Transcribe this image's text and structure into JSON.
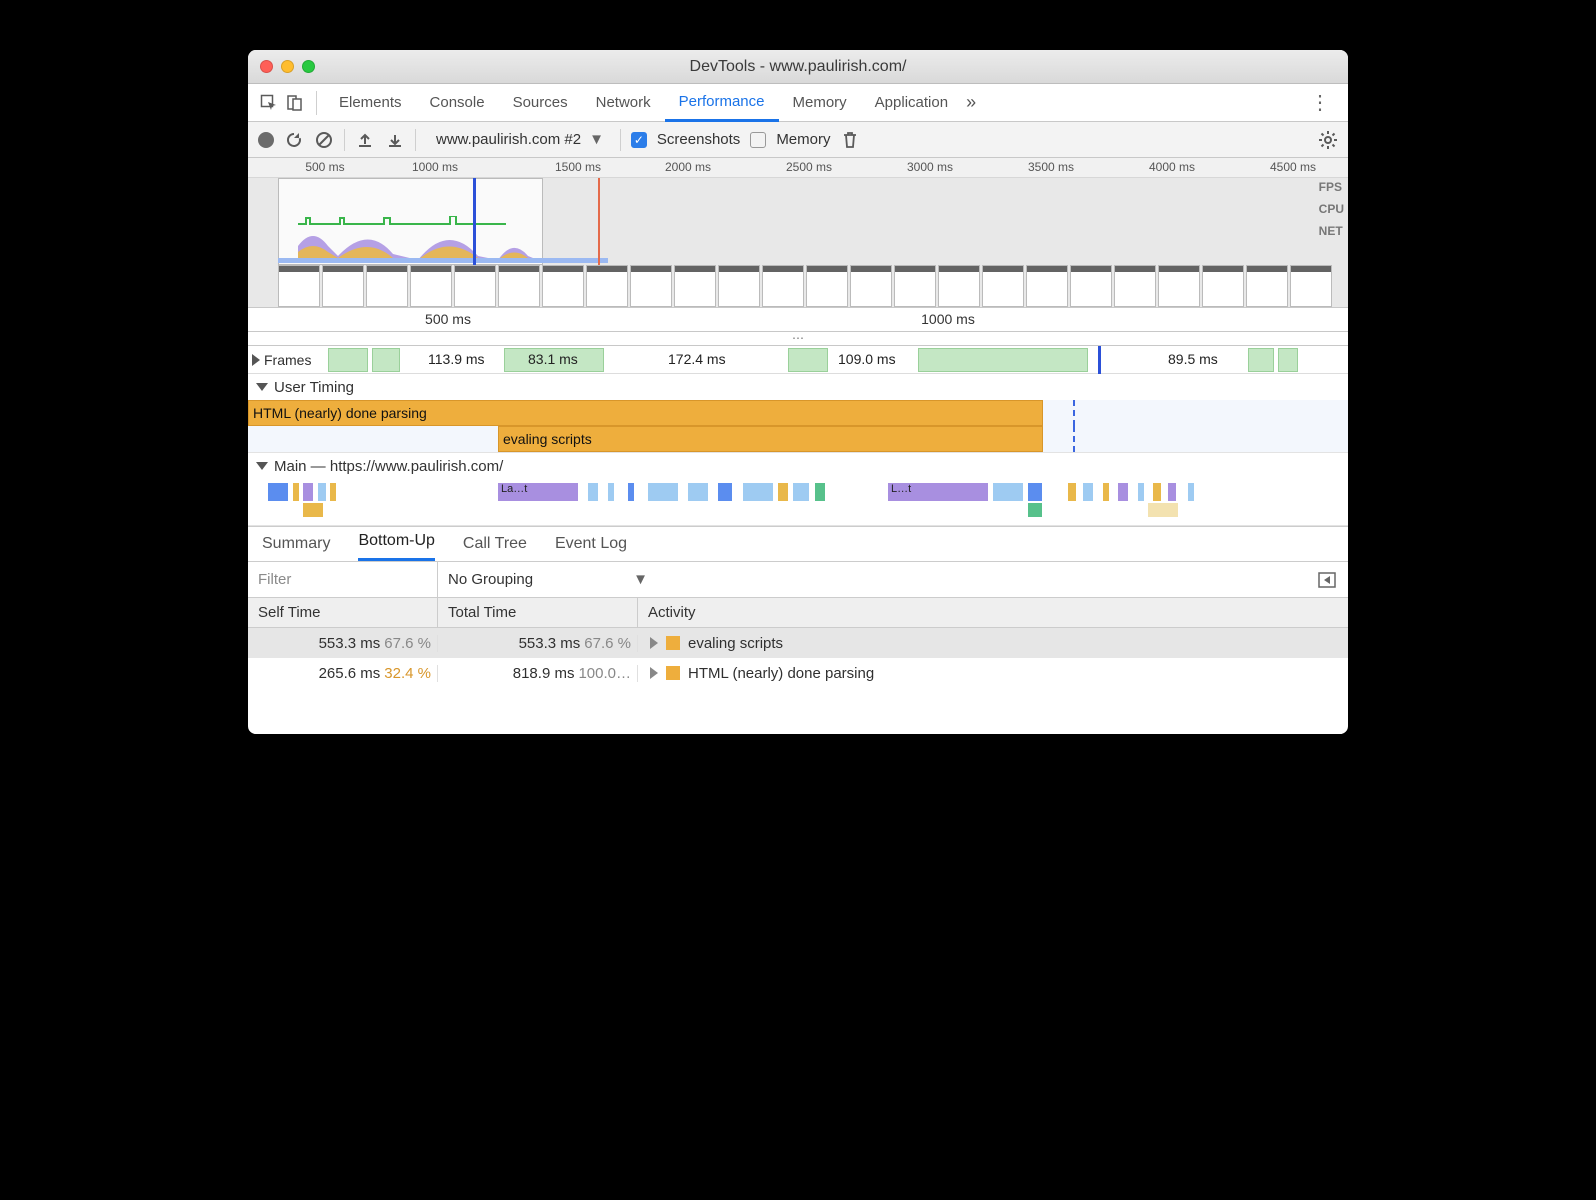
{
  "window": {
    "title": "DevTools - www.paulirish.com/"
  },
  "tabs": [
    "Elements",
    "Console",
    "Sources",
    "Network",
    "Performance",
    "Memory",
    "Application"
  ],
  "tabs_active_index": 4,
  "toolbar": {
    "recording_label": "www.paulirish.com #2",
    "screenshots_label": "Screenshots",
    "memory_label": "Memory",
    "screenshots_checked": true,
    "memory_checked": false
  },
  "overview": {
    "ticks": [
      "500 ms",
      "1000 ms",
      "1500 ms",
      "2000 ms",
      "2500 ms",
      "3000 ms",
      "3500 ms",
      "4000 ms",
      "4500 ms"
    ],
    "side_labels": [
      "FPS",
      "CPU",
      "NET"
    ]
  },
  "ruler2": {
    "ticks": [
      "500 ms",
      "1000 ms"
    ]
  },
  "frames": {
    "label": "Frames",
    "times": [
      "113.9 ms",
      "83.1 ms",
      "172.4 ms",
      "109.0 ms",
      "89.5 ms"
    ]
  },
  "user_timing": {
    "label": "User Timing",
    "bars": [
      "HTML (nearly) done parsing",
      "evaling scripts"
    ]
  },
  "main": {
    "label": "Main — https://www.paulirish.com/",
    "snips": [
      "La…t",
      "L…t"
    ]
  },
  "bottom_tabs": [
    "Summary",
    "Bottom-Up",
    "Call Tree",
    "Event Log"
  ],
  "bottom_tabs_active_index": 1,
  "filter": {
    "placeholder": "Filter",
    "grouping": "No Grouping"
  },
  "table": {
    "headers": [
      "Self Time",
      "Total Time",
      "Activity"
    ],
    "rows": [
      {
        "self_ms": "553.3 ms",
        "self_pct": "67.6 %",
        "total_ms": "553.3 ms",
        "total_pct": "67.6 %",
        "activity": "evaling scripts",
        "total_bar_pct": 67.6
      },
      {
        "self_ms": "265.6 ms",
        "self_pct": "32.4 %",
        "total_ms": "818.9 ms",
        "total_pct": "100.0…",
        "activity": "HTML (nearly) done parsing",
        "total_bar_pct": 100
      }
    ]
  }
}
